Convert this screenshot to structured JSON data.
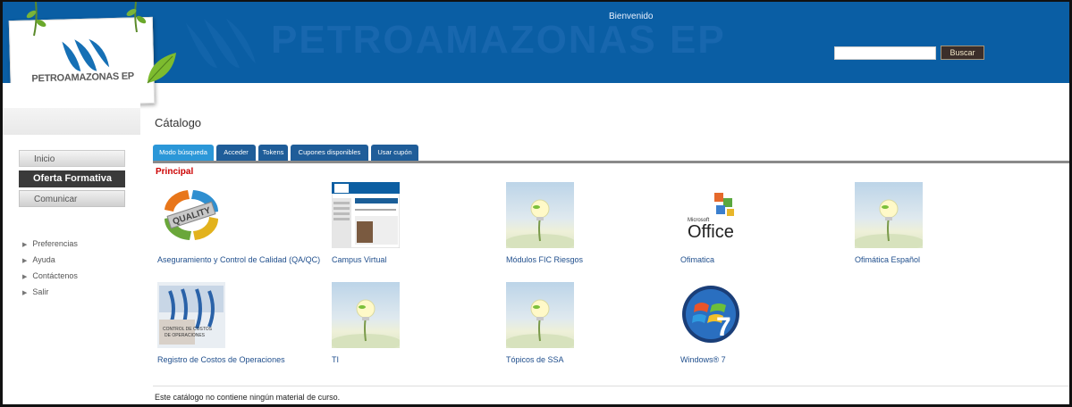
{
  "header": {
    "welcome": "Bienvenido",
    "watermark": "PETROAMAZONAS EP",
    "search": {
      "value": "",
      "placeholder": ""
    },
    "search_button": "Buscar"
  },
  "logo": {
    "text": "PETROAMAZONAS EP",
    "brand_blue": "#0a5ea4",
    "leaf_green": "#6aa82a"
  },
  "sidebar": {
    "nav": [
      "Inicio",
      "Oferta Formativa",
      "Comunicar"
    ],
    "links": [
      "Preferencias",
      "Ayuda",
      "Contáctenos",
      "Salir"
    ]
  },
  "catalog": {
    "title": "Cátalogo",
    "tabs": [
      "Modo búsqueda",
      "Acceder",
      "Tokens",
      "Cupones disponibles",
      "Usar cupón"
    ],
    "active_tab": "Modo búsqueda",
    "section": "Principal",
    "courses": [
      {
        "name": "Aseguramiento y Control de Calidad (QA/QC)",
        "icon": "quality-cycle-icon"
      },
      {
        "name": "Campus Virtual",
        "icon": "website-screenshot-icon"
      },
      {
        "name": "Módulos FIC Riesgos",
        "icon": "lightbulb-plant-icon"
      },
      {
        "name": "Ofimatica",
        "icon": "microsoft-office-logo-icon"
      },
      {
        "name": "Ofimática Español",
        "icon": "lightbulb-plant-icon"
      },
      {
        "name": "Registro de Costos de Operaciones",
        "icon": "cost-control-icon"
      },
      {
        "name": "TI",
        "icon": "lightbulb-plant-icon"
      },
      {
        "name": "Tópicos de SSA",
        "icon": "lightbulb-plant-icon"
      },
      {
        "name": "Windows® 7",
        "icon": "windows-7-logo-icon"
      }
    ],
    "empty_message": "Este catálogo no contiene ningún material de curso.",
    "principal_color": "#cc0000",
    "tab_color": "#1f5d99",
    "tab_active_color": "#2b97d8"
  },
  "thumb_text": {
    "quality": "QUALITY",
    "office_brand": "Microsoft",
    "office_word": "Office",
    "windows_version": "7",
    "cost_line1": "CONTROL DE COSTOS",
    "cost_line2": "DE OPERACIONES"
  }
}
